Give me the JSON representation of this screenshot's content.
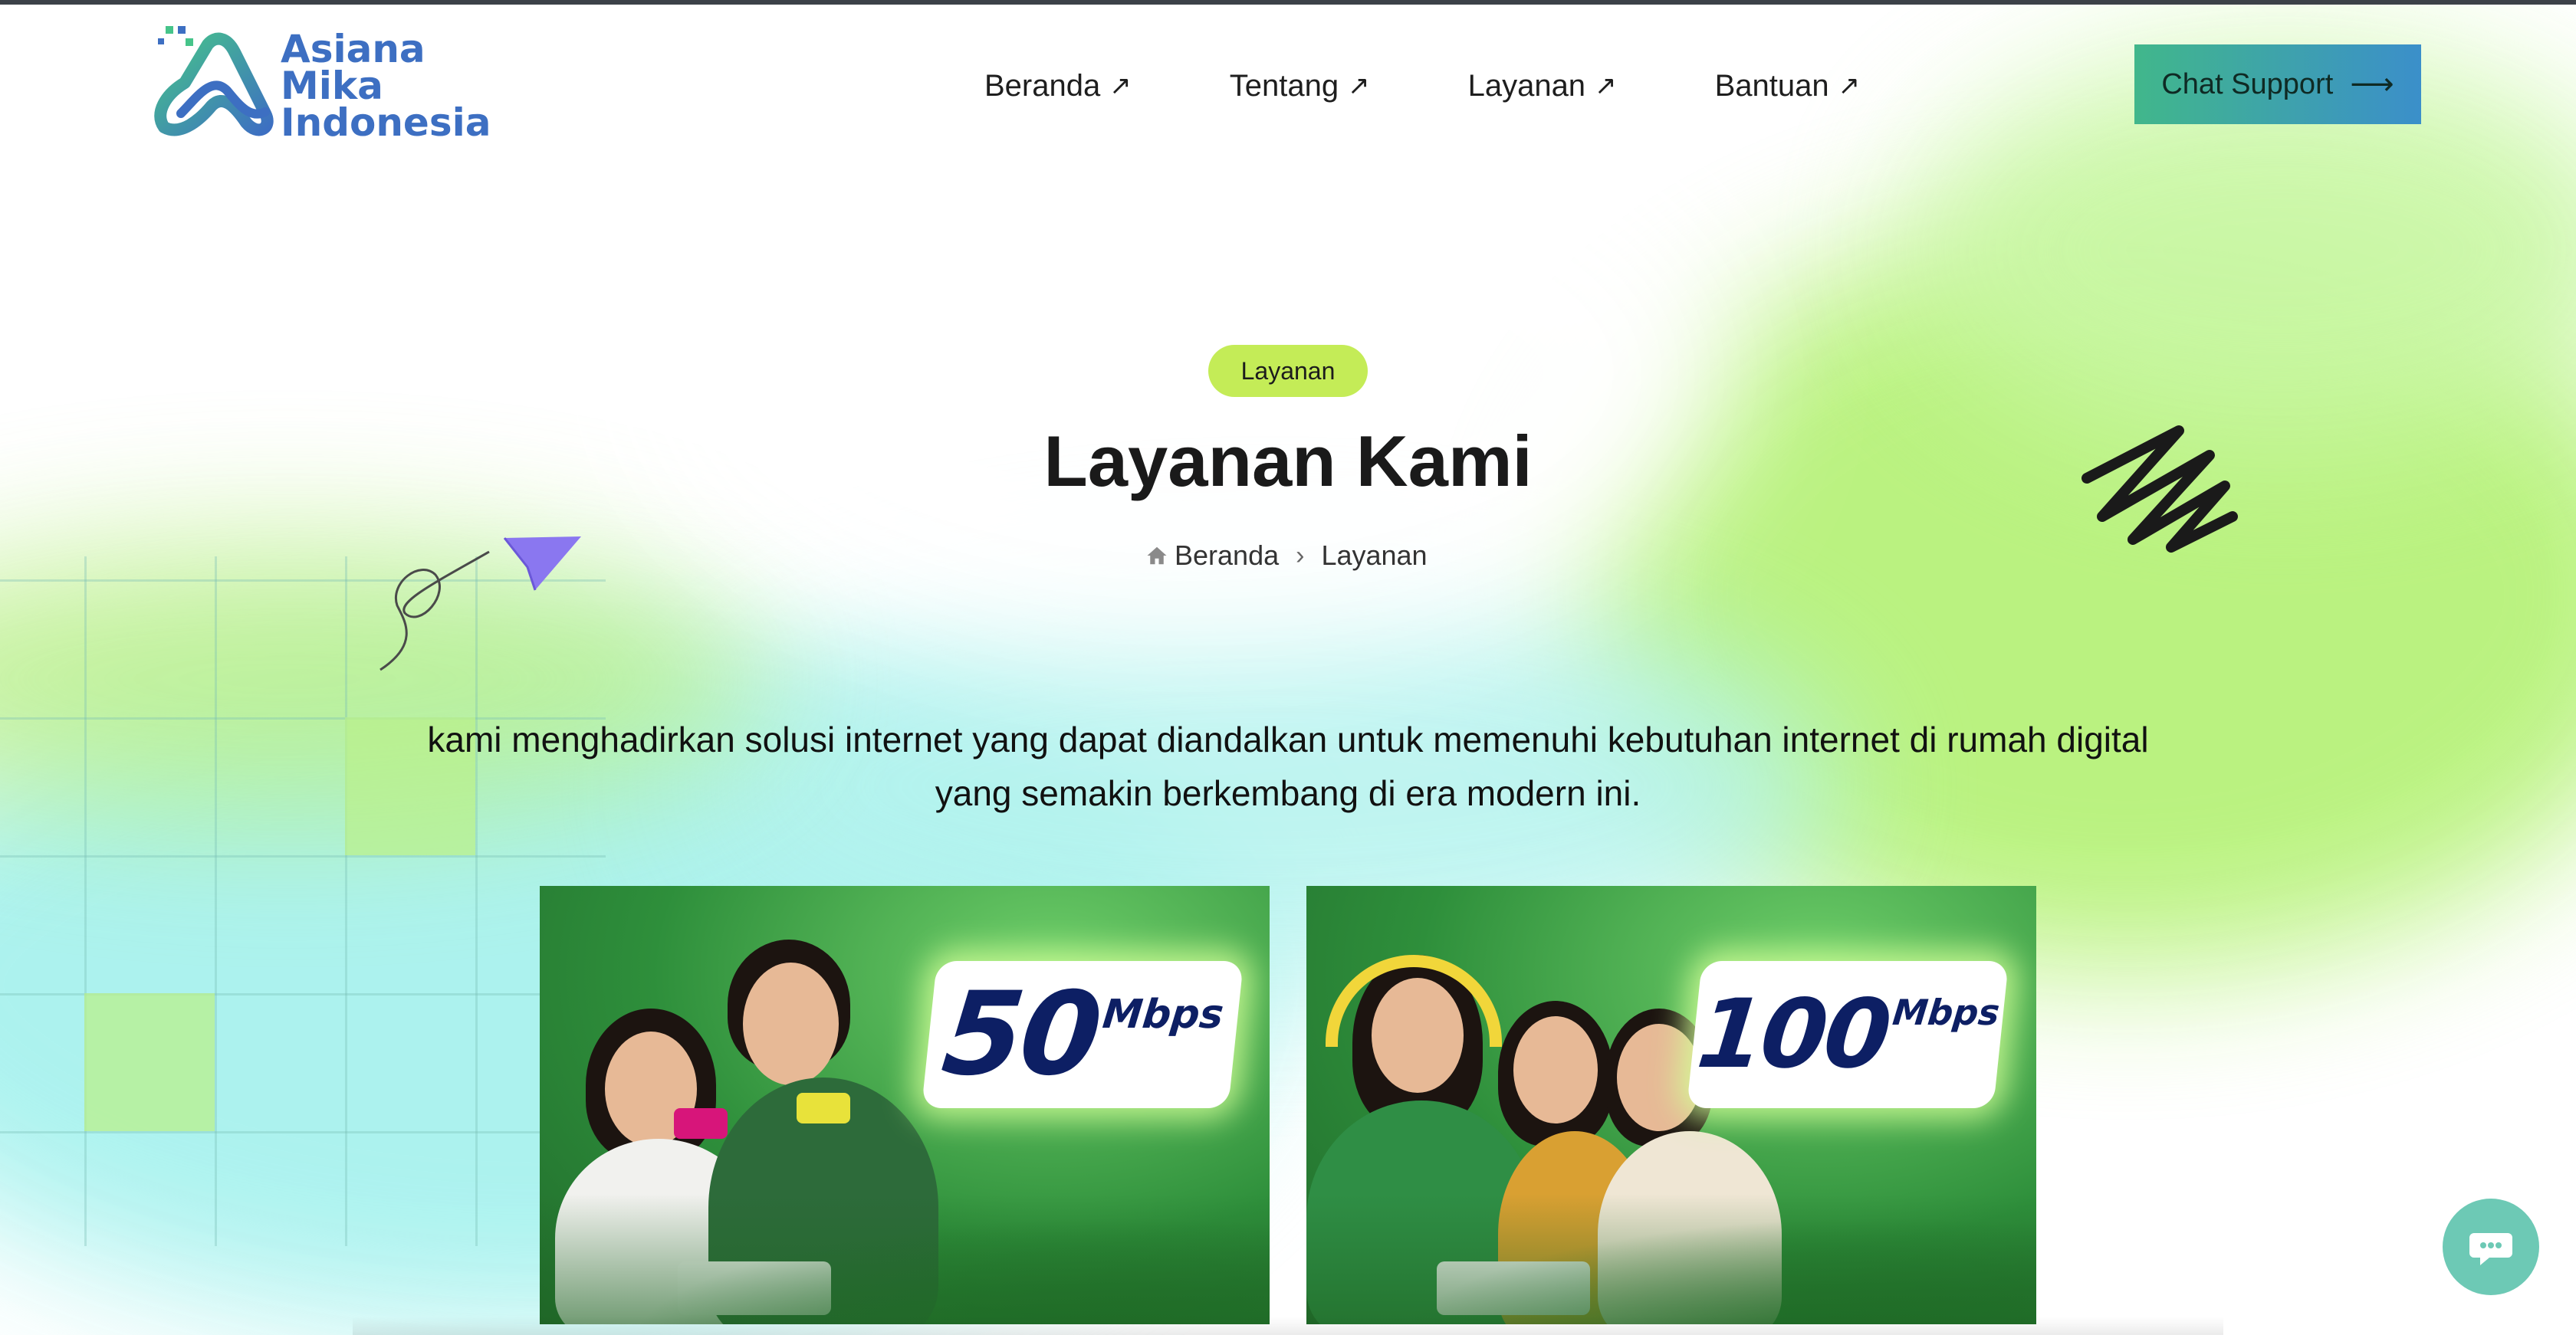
{
  "brand": {
    "line1": "Asiana",
    "line2": "Mika",
    "line3": "Indonesia"
  },
  "nav": {
    "items": [
      {
        "label": "Beranda",
        "icon": "arrow-up-right-icon"
      },
      {
        "label": "Tentang",
        "icon": "arrow-up-right-icon"
      },
      {
        "label": "Layanan",
        "icon": "arrow-up-right-icon"
      },
      {
        "label": "Bantuan",
        "icon": "arrow-up-right-icon"
      }
    ],
    "cta_label": "Chat Support",
    "cta_icon": "arrow-right-icon"
  },
  "hero": {
    "pill": "Layanan",
    "title": "Layanan Kami",
    "breadcrumb": {
      "home_icon": "home-icon",
      "home": "Beranda",
      "current": "Layanan"
    },
    "intro_line1": "kami menghadirkan solusi internet yang dapat diandalkan untuk memenuhi kebutuhan internet di rumah digital",
    "intro_line2": "yang semakin berkembang di era modern ini."
  },
  "cards": [
    {
      "speed": "50",
      "unit": "Mbps"
    },
    {
      "speed": "100",
      "unit": "Mbps"
    }
  ],
  "colors": {
    "pill": "#c4ec57",
    "cta_start": "#41b78b",
    "cta_end": "#3b8fca",
    "logo": "#3d6fc2",
    "badge_text": "#0d1f64",
    "fab": "#6dc9b5"
  },
  "fab_icon": "chat-bubble-icon"
}
